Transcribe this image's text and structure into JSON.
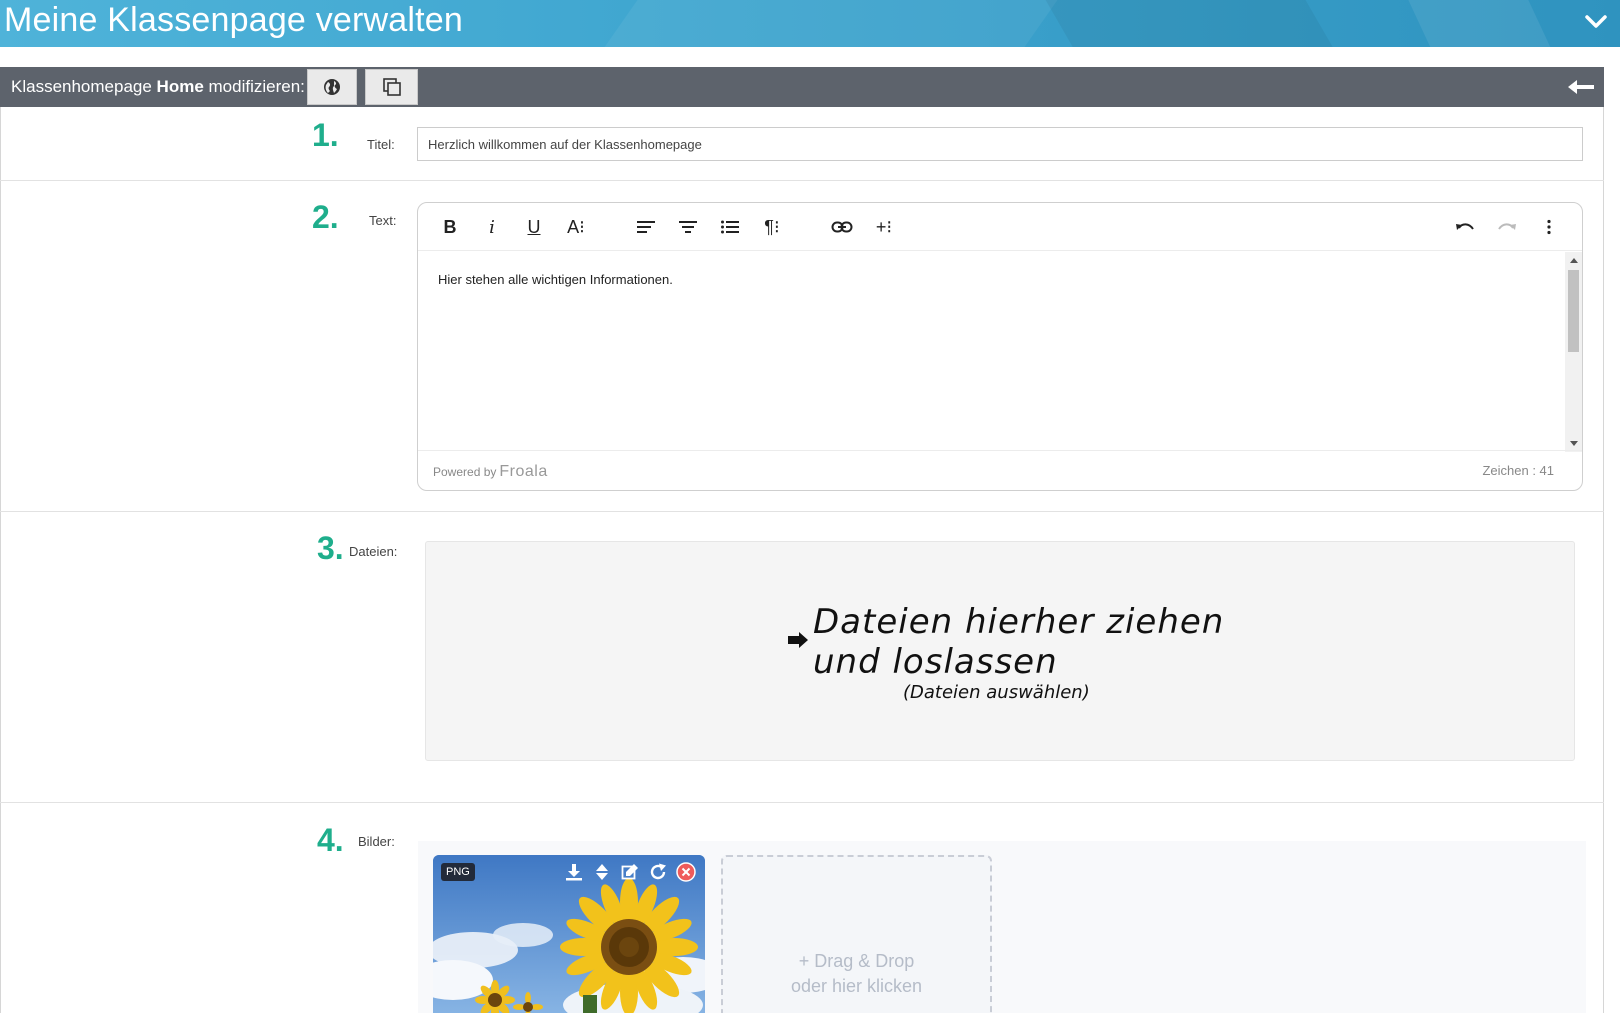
{
  "header": {
    "title": "Meine Klassenpage verwalten"
  },
  "toolbar": {
    "title_prefix": "Klassenhomepage ",
    "title_bold": "Home",
    "title_suffix": " modifizieren:"
  },
  "sections": {
    "s1": {
      "number": "1",
      "label": "Titel:"
    },
    "s2": {
      "number": "2",
      "label": "Text:"
    },
    "s3": {
      "number": "3",
      "label": "Dateien:"
    },
    "s4": {
      "number": "4",
      "label": "Bilder:"
    }
  },
  "title_field": {
    "value": "Herzlich willkommen auf der Klassenhomepage"
  },
  "editor": {
    "content": "Hier stehen alle wichtigen Informationen.",
    "powered_by": "Powered by",
    "brand": "Froala",
    "char_count": "Zeichen : 41",
    "tools": [
      "bold-icon",
      "italic-icon",
      "underline-icon",
      "font-size-icon",
      "align-left-icon",
      "align-center-icon",
      "list-icon",
      "paragraph-format-icon",
      "link-icon",
      "insert-more-icon",
      "undo-icon",
      "redo-icon",
      "more-vertical-icon"
    ]
  },
  "files": {
    "drop_text_line1": "Dateien hierher ziehen",
    "drop_text_line2": "und loslassen",
    "select_text": "(Dateien auswählen)"
  },
  "images": {
    "items": [
      {
        "type_badge": "PNG"
      }
    ],
    "add_tile_line1": "+ Drag & Drop",
    "add_tile_line2": "oder hier klicken"
  },
  "colors": {
    "banner": "#3ea5cf",
    "toolbar": "#5d636c",
    "step_number": "#1fae8c"
  }
}
